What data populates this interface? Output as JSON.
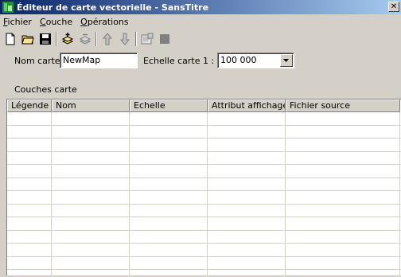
{
  "window": {
    "title": "Éditeur de carte vectorielle - SansTitre",
    "close_label": "✕"
  },
  "menu": [
    {
      "label": "Fichier",
      "underline": "F"
    },
    {
      "label": "Couche",
      "underline": "C"
    },
    {
      "label": "Opérations",
      "underline": "O"
    }
  ],
  "toolbar": {
    "buttons": [
      "new-file-icon",
      "open-folder-icon",
      "save-icon",
      "add-layer-icon",
      "remove-layer-icon",
      "move-up-icon",
      "move-down-icon",
      "properties-icon",
      "stop-icon"
    ]
  },
  "form": {
    "map_name_label": "Nom carte",
    "map_name_value": "NewMap",
    "scale_label": "Echelle carte 1 :",
    "scale_value": "100 000"
  },
  "layers": {
    "section_label": "Couches carte",
    "columns": [
      "Légende",
      "Nom",
      "Echelle",
      "Attribut affichage",
      "Fichier source"
    ],
    "row_count": 13
  }
}
